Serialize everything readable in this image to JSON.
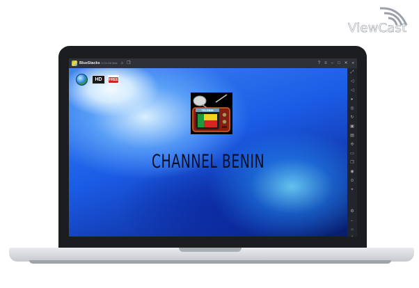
{
  "watermark": {
    "text": "ViewCast"
  },
  "window": {
    "app_name": "BlueStacks",
    "version": "5.0.5.128 Beta",
    "titlebar_icons": [
      "home-icon",
      "copy-icon"
    ],
    "controls": [
      "help-icon",
      "menu-icon",
      "minimize-icon",
      "maximize-icon",
      "close-icon",
      "collapse-icon"
    ]
  },
  "sidebar": {
    "icons": [
      "expand-icon",
      "volume-up-icon",
      "volume-down-icon",
      "play-icon",
      "screenshot-icon",
      "rotate-icon",
      "media-icon",
      "apk-icon",
      "shake-icon",
      "folder-icon",
      "multi-instance-icon",
      "macro-icon",
      "eco-icon",
      "location-icon",
      "settings-icon",
      "back-icon",
      "home-icon",
      "recent-apps-icon"
    ]
  },
  "app": {
    "title": "CHANNEL BENIN",
    "hd_label": "HD",
    "free_label": "FREE",
    "icon_sign": "TELEBIN"
  }
}
